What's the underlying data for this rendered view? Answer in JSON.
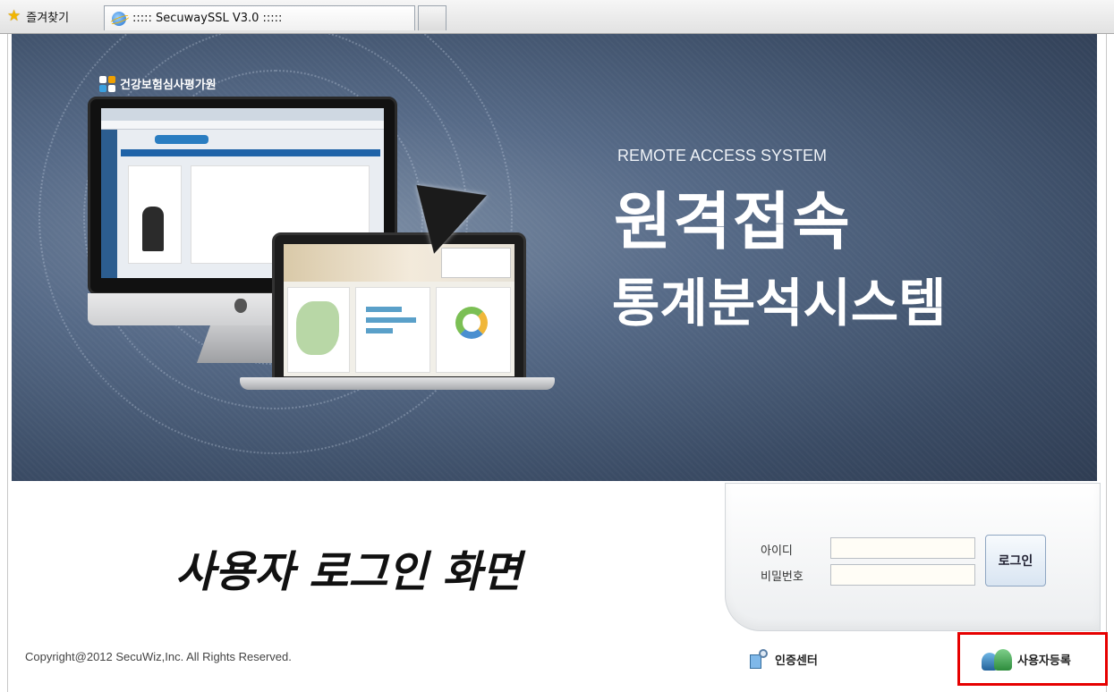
{
  "browser": {
    "favorites_label": "즐겨찾기",
    "tab_title": "::::: SecuwaySSL V3.0 :::::"
  },
  "banner": {
    "org_name": "건강보험심사평가원",
    "remote_label": "REMOTE ACCESS SYSTEM",
    "title": "원격접속",
    "subtitle": "통계분석시스템"
  },
  "caption": "사용자 로그인 화면",
  "login": {
    "id_label": "아이디",
    "password_label": "비밀번호",
    "id_value": "",
    "password_value": "",
    "login_button": "로그인"
  },
  "footer": {
    "copyright": "Copyright@2012 SecuWiz,Inc. All Rights Reserved.",
    "auth_center": "인증센터",
    "user_register": "사용자등록"
  },
  "colors": {
    "highlight": "#e60000",
    "banner_dark": "#2f3d53",
    "banner_light": "#7d8ea5"
  }
}
